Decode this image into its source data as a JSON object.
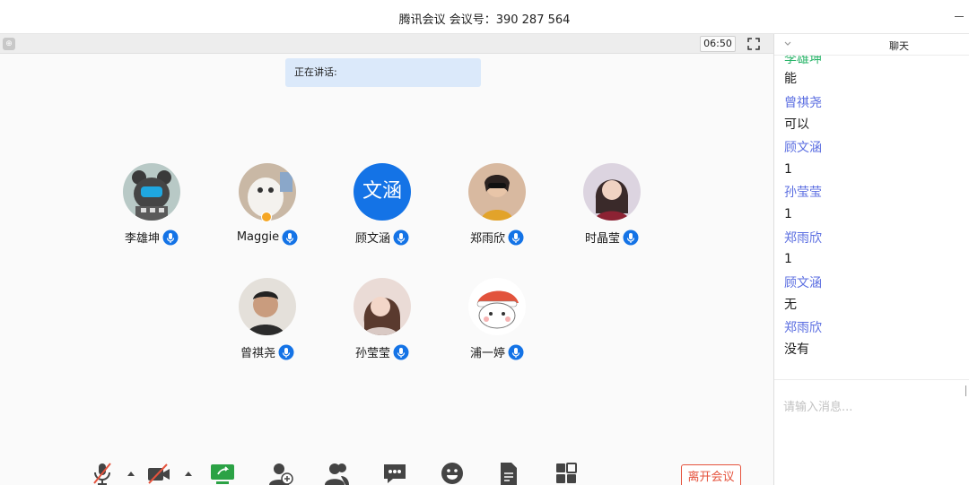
{
  "window": {
    "title": "腾讯会议 会议号：390 287 564"
  },
  "stage": {
    "timer": "06:50",
    "speaking_label": "正在讲话:",
    "participants": [
      {
        "name": "李雄坤",
        "avatar": "bear-with-mask"
      },
      {
        "name": "Maggie",
        "avatar": "white-cat",
        "host": true
      },
      {
        "name": "顾文涵",
        "avatar_text": "文涵",
        "avatar_color": "#1473e6"
      },
      {
        "name": "郑雨欣",
        "avatar": "girl-photo"
      },
      {
        "name": "时晶莹",
        "avatar": "girl-photo"
      },
      {
        "name": "曾祺尧",
        "avatar": "boy-photo"
      },
      {
        "name": "孙莹莹",
        "avatar": "girl-photo"
      },
      {
        "name": "浦一婷",
        "avatar": "cartoon-santa-cat"
      }
    ]
  },
  "toolbar": {
    "buttons": [
      "mic-muted-icon",
      "camera-off-icon",
      "share-screen-icon",
      "invite-icon",
      "members-icon",
      "chat-icon",
      "emoji-icon",
      "document-icon",
      "layout-icon"
    ],
    "leave_label": "离开会议",
    "accent_color": "#e5533d",
    "share_color": "#2ba245"
  },
  "chat": {
    "title": "聊天",
    "messages": [
      {
        "text": "能"
      },
      {
        "sender": "曾祺尧",
        "text": "可以"
      },
      {
        "sender": "顾文涵",
        "text": "1"
      },
      {
        "sender": "孙莹莹",
        "text": "1"
      },
      {
        "sender": "郑雨欣",
        "text": "1"
      },
      {
        "sender": "顾文涵",
        "text": "无"
      },
      {
        "sender": "郑雨欣",
        "text": "没有"
      }
    ],
    "input_placeholder": "请输入消息...",
    "sender_color": "#5b6ee1"
  }
}
